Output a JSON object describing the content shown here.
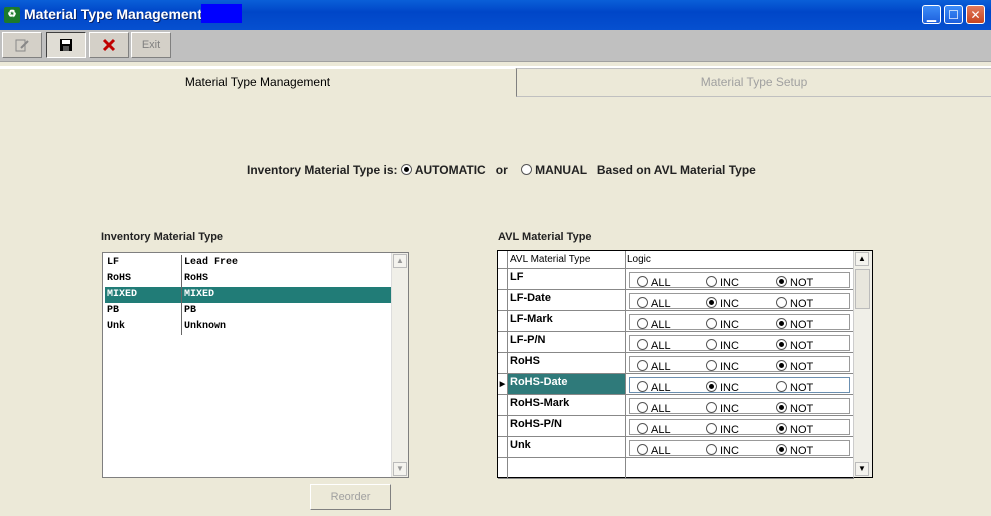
{
  "window": {
    "title": "Material Type Management",
    "controls": {
      "minimize_icon": "minimize-icon",
      "maximize_icon": "maximize-icon",
      "close_icon": "close-icon"
    }
  },
  "toolbar": {
    "exit_label": "Exit"
  },
  "tabs": [
    {
      "label": "Material Type Management",
      "active": true
    },
    {
      "label": "Material Type Setup",
      "active": false
    }
  ],
  "question": {
    "prefix": "Inventory Material Type is:",
    "option_automatic": "AUTOMATIC",
    "or_text": "or",
    "option_manual": "MANUAL",
    "suffix": "Based on AVL Material Type",
    "selected": "AUTOMATIC"
  },
  "inventory": {
    "title": "Inventory Material Type",
    "rows": [
      {
        "code": "LF",
        "desc": "Lead Free",
        "selected": false
      },
      {
        "code": "RoHS",
        "desc": "RoHS",
        "selected": false
      },
      {
        "code": "MIXED",
        "desc": "MIXED",
        "selected": true
      },
      {
        "code": "PB",
        "desc": "PB",
        "selected": false
      },
      {
        "code": "Unk",
        "desc": "Unknown",
        "selected": false
      }
    ],
    "reorder_label": "Reorder"
  },
  "avl": {
    "title": "AVL Material Type",
    "col_name": "AVL Material Type",
    "col_logic": "Logic",
    "opt_all": "ALL",
    "opt_inc": "INC",
    "opt_not": "NOT",
    "rows": [
      {
        "name": "LF",
        "logic": "NOT"
      },
      {
        "name": "LF-Date",
        "logic": "INC"
      },
      {
        "name": "LF-Mark",
        "logic": "NOT"
      },
      {
        "name": "LF-P/N",
        "logic": "NOT"
      },
      {
        "name": "RoHS",
        "logic": "NOT"
      },
      {
        "name": "RoHS-Date",
        "logic": "INC",
        "selected": true
      },
      {
        "name": "RoHS-Mark",
        "logic": "NOT"
      },
      {
        "name": "RoHS-P/N",
        "logic": "NOT"
      },
      {
        "name": "Unk",
        "logic": "NOT"
      }
    ]
  }
}
